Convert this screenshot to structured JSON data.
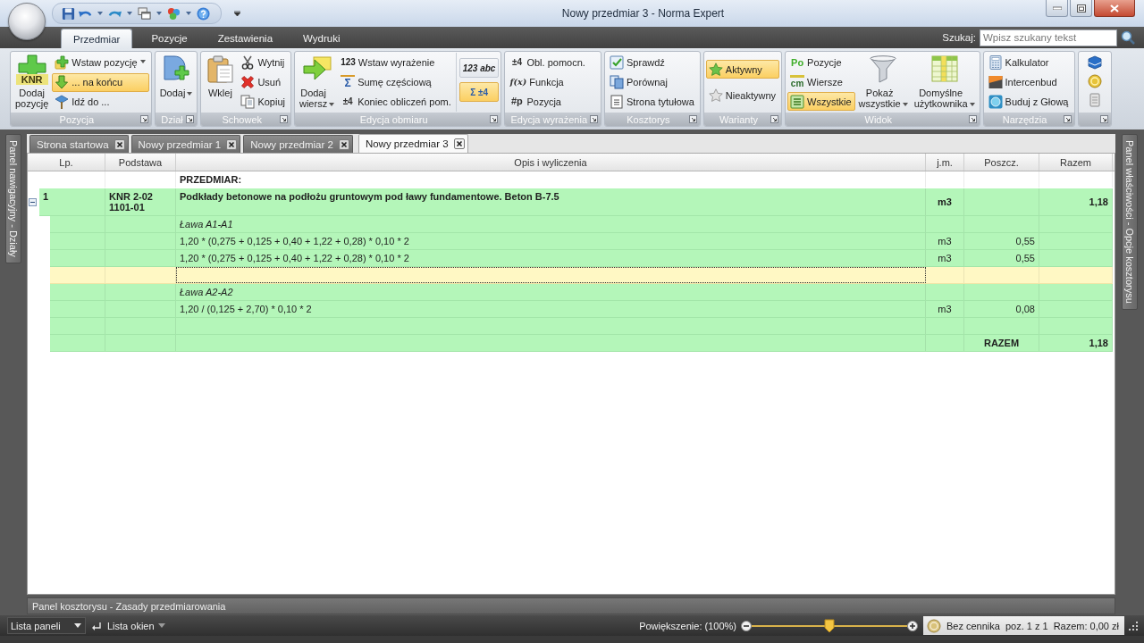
{
  "window": {
    "title": "Nowy przedmiar 3 - Norma Expert"
  },
  "menu_tabs": [
    {
      "label": "Przedmiar",
      "selected": true
    },
    {
      "label": "Pozycje",
      "selected": false
    },
    {
      "label": "Zestawienia",
      "selected": false
    },
    {
      "label": "Wydruki",
      "selected": false
    }
  ],
  "search": {
    "label": "Szukaj:",
    "placeholder": "Wpisz szukany tekst"
  },
  "ribbon": {
    "groups": [
      {
        "label": "Pozycja",
        "items": [
          {
            "kind": "large",
            "label": "Dodaj pozycję",
            "icon_text": "KNR"
          },
          {
            "kind": "small",
            "label": "Wstaw pozycję",
            "dropdown": true,
            "selected": false
          },
          {
            "kind": "small",
            "label": "... na końcu",
            "selected": true
          },
          {
            "kind": "small",
            "label": "Idź do ...",
            "selected": false
          }
        ]
      },
      {
        "label": "Dział",
        "items": [
          {
            "kind": "large",
            "label": "Dodaj",
            "dropdown": true
          }
        ]
      },
      {
        "label": "Schowek",
        "items": [
          {
            "kind": "large",
            "label": "Wklej"
          },
          {
            "kind": "small",
            "label": "Wytnij"
          },
          {
            "kind": "small",
            "label": "Usuń"
          },
          {
            "kind": "small",
            "label": "Kopiuj"
          }
        ]
      },
      {
        "label": "Edycja obmiaru",
        "items": [
          {
            "kind": "large",
            "label": "Dodaj wiersz",
            "dropdown": true
          },
          {
            "kind": "small",
            "label": "Wstaw wyrażenie",
            "icon_text": "123"
          },
          {
            "kind": "small",
            "label": "Sumę częściową",
            "icon_text": "Σ"
          },
          {
            "kind": "small",
            "label": "Koniec obliczeń pom.",
            "icon_text": "±4"
          },
          {
            "kind": "toggle",
            "icon_text": "123 abc",
            "selected": false
          },
          {
            "kind": "toggle",
            "icon_text": "Σ ±4",
            "selected": true
          }
        ]
      },
      {
        "label": "Edycja wyrażenia",
        "items": [
          {
            "kind": "small",
            "label": "Obl. pomocn.",
            "icon_text": "±4"
          },
          {
            "kind": "small",
            "label": "Funkcja",
            "icon_text": "f(x)"
          },
          {
            "kind": "small",
            "label": "Pozycja",
            "icon_text": "#p"
          }
        ]
      },
      {
        "label": "Kosztorys",
        "items": [
          {
            "kind": "small",
            "label": "Sprawdź"
          },
          {
            "kind": "small",
            "label": "Porównaj"
          },
          {
            "kind": "small",
            "label": "Strona tytułowa"
          }
        ]
      },
      {
        "label": "Warianty",
        "items": [
          {
            "kind": "small",
            "label": "Aktywny",
            "selected": true
          },
          {
            "kind": "small",
            "label": "Nieaktywny",
            "selected": false
          }
        ]
      },
      {
        "label": "Widok",
        "items": [
          {
            "kind": "small",
            "label": "Pozycje",
            "icon_text": "Po",
            "selected": false
          },
          {
            "kind": "small",
            "label": "Wiersze",
            "icon_text": "cm",
            "selected": false
          },
          {
            "kind": "small",
            "label": "Wszystkie",
            "selected": true
          },
          {
            "kind": "large",
            "label": "Pokaż wszystkie",
            "dropdown": true
          },
          {
            "kind": "large",
            "label": "Domyślne użytkownika",
            "dropdown": true
          }
        ]
      },
      {
        "label": "Narzędzia",
        "items": [
          {
            "kind": "small",
            "label": "Kalkulator"
          },
          {
            "kind": "small",
            "label": "Intercenbud"
          },
          {
            "kind": "small",
            "label": "Buduj z Głową"
          }
        ]
      },
      {
        "items": [
          {
            "kind": "icon"
          },
          {
            "kind": "icon"
          },
          {
            "kind": "icon"
          }
        ]
      }
    ]
  },
  "side_panels": {
    "left": "Panel nawigacyjny - Działy",
    "right": "Panel właściwości - Opcje kosztorysu"
  },
  "document_tabs": [
    {
      "label": "Strona startowa",
      "selected": false
    },
    {
      "label": "Nowy przedmiar 1",
      "selected": false
    },
    {
      "label": "Nowy przedmiar 2",
      "selected": false
    },
    {
      "label": "Nowy przedmiar 3",
      "selected": true
    }
  ],
  "table": {
    "columns": [
      "Lp.",
      "Podstawa",
      "Opis i wyliczenia",
      "j.m.",
      "Poszcz.",
      "Razem"
    ],
    "rows": [
      {
        "kind": "heading",
        "selected": false,
        "description": "PRZEDMIAR:"
      },
      {
        "kind": "position",
        "selected": false,
        "expanded": true,
        "lp": "1",
        "basis": "KNR 2-02 1101-01",
        "description": "Podkłady betonowe na podłożu gruntowym pod ławy fundamentowe. Beton B-7.5",
        "unit": "m3",
        "total": "1,18"
      },
      {
        "kind": "label",
        "selected": false,
        "description": "Ława A1-A1"
      },
      {
        "kind": "formula",
        "selected": false,
        "description": "1,20 * (0,275 + 0,125 + 0,40 + 1,22 + 0,28) * 0,10 * 2",
        "unit": "m3",
        "partial": "0,55"
      },
      {
        "kind": "formula",
        "selected": false,
        "description": "1,20 * (0,275 + 0,125 + 0,40 + 1,22 + 0,28) * 0,10 * 2",
        "unit": "m3",
        "partial": "0,55"
      },
      {
        "kind": "formula",
        "selected": true
      },
      {
        "kind": "label",
        "selected": false,
        "description": "Ława A2-A2"
      },
      {
        "kind": "formula",
        "selected": false,
        "description": "1,20 / (0,125 + 2,70) * 0,10 * 2",
        "unit": "m3",
        "partial": "0,08"
      },
      {
        "kind": "formula",
        "selected": false
      },
      {
        "kind": "total",
        "selected": false,
        "label": "RAZEM",
        "total": "1,18"
      }
    ]
  },
  "bottom_panel": {
    "title": "Panel kosztorysu - Zasady przedmiarowania"
  },
  "status_bar": {
    "panels_list": "Lista paneli",
    "windows_list": "Lista okien",
    "zoom_label": "Powiększenie: (100%)",
    "zoom": {
      "level": 0.5
    },
    "price_list": "Bez cennika",
    "position": "poz. 1 z 1",
    "total": "Razem: 0,00 zł"
  }
}
